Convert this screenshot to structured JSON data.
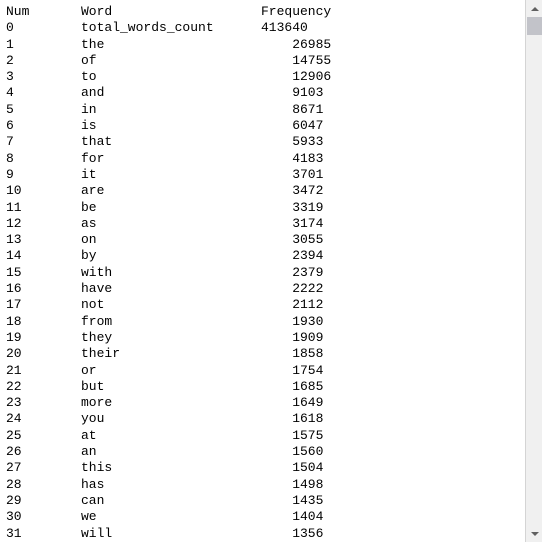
{
  "headers": {
    "num": "Num",
    "word": "Word",
    "frequency": "Frequency"
  },
  "rows": [
    {
      "num": "0",
      "word": "total_words_count",
      "freq": "413640",
      "indent": false
    },
    {
      "num": "1",
      "word": "the",
      "freq": "26985",
      "indent": true
    },
    {
      "num": "2",
      "word": "of",
      "freq": "14755",
      "indent": true
    },
    {
      "num": "3",
      "word": "to",
      "freq": "12906",
      "indent": true
    },
    {
      "num": "4",
      "word": "and",
      "freq": "9103",
      "indent": true
    },
    {
      "num": "5",
      "word": "in",
      "freq": "8671",
      "indent": true
    },
    {
      "num": "6",
      "word": "is",
      "freq": "6047",
      "indent": true
    },
    {
      "num": "7",
      "word": "that",
      "freq": "5933",
      "indent": true
    },
    {
      "num": "8",
      "word": "for",
      "freq": "4183",
      "indent": true
    },
    {
      "num": "9",
      "word": "it",
      "freq": "3701",
      "indent": true
    },
    {
      "num": "10",
      "word": "are",
      "freq": "3472",
      "indent": true
    },
    {
      "num": "11",
      "word": "be",
      "freq": "3319",
      "indent": true
    },
    {
      "num": "12",
      "word": "as",
      "freq": "3174",
      "indent": true
    },
    {
      "num": "13",
      "word": "on",
      "freq": "3055",
      "indent": true
    },
    {
      "num": "14",
      "word": "by",
      "freq": "2394",
      "indent": true
    },
    {
      "num": "15",
      "word": "with",
      "freq": "2379",
      "indent": true
    },
    {
      "num": "16",
      "word": "have",
      "freq": "2222",
      "indent": true
    },
    {
      "num": "17",
      "word": "not",
      "freq": "2112",
      "indent": true
    },
    {
      "num": "18",
      "word": "from",
      "freq": "1930",
      "indent": true
    },
    {
      "num": "19",
      "word": "they",
      "freq": "1909",
      "indent": true
    },
    {
      "num": "20",
      "word": "their",
      "freq": "1858",
      "indent": true
    },
    {
      "num": "21",
      "word": "or",
      "freq": "1754",
      "indent": true
    },
    {
      "num": "22",
      "word": "but",
      "freq": "1685",
      "indent": true
    },
    {
      "num": "23",
      "word": "more",
      "freq": "1649",
      "indent": true
    },
    {
      "num": "24",
      "word": "you",
      "freq": "1618",
      "indent": true
    },
    {
      "num": "25",
      "word": "at",
      "freq": "1575",
      "indent": true
    },
    {
      "num": "26",
      "word": "an",
      "freq": "1560",
      "indent": true
    },
    {
      "num": "27",
      "word": "this",
      "freq": "1504",
      "indent": true
    },
    {
      "num": "28",
      "word": "has",
      "freq": "1498",
      "indent": true
    },
    {
      "num": "29",
      "word": "can",
      "freq": "1435",
      "indent": true
    },
    {
      "num": "30",
      "word": "we",
      "freq": "1404",
      "indent": true
    },
    {
      "num": "31",
      "word": "will",
      "freq": "1356",
      "indent": true
    }
  ]
}
